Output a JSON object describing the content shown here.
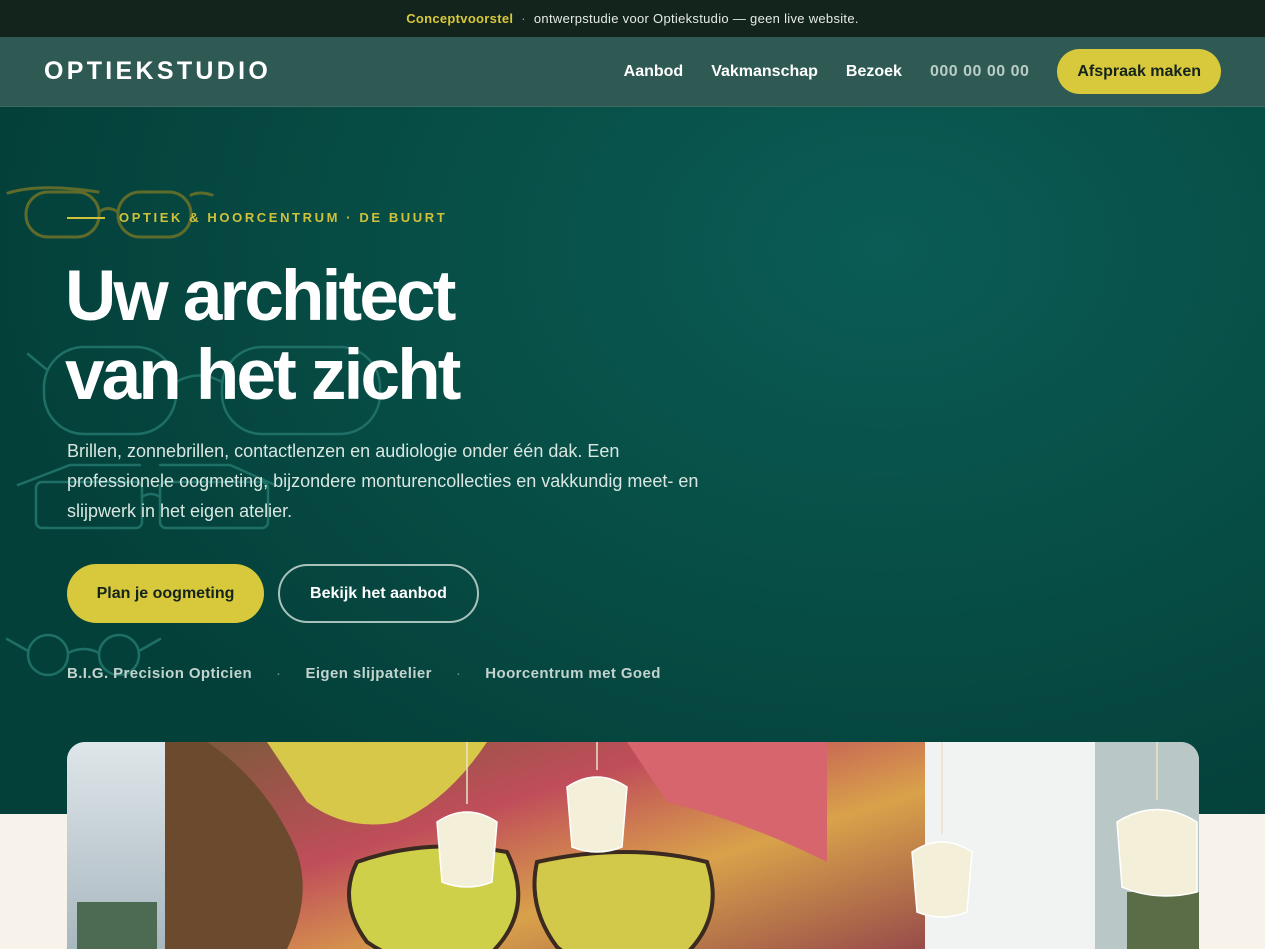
{
  "notice": {
    "tag": "Conceptvoorstel",
    "separator": "·",
    "text": "ontwerpstudie voor Optiekstudio — geen live website."
  },
  "nav": {
    "logo": "OPTIEKSTUDIO",
    "links": [
      "Aanbod",
      "Vakmanschap",
      "Bezoek"
    ],
    "phone": "000 00 00 00",
    "cta": "Afspraak maken"
  },
  "hero": {
    "eyebrow": "OPTIEK & HOORCENTRUM · DE BUURT",
    "headline_line1": "Uw architect",
    "headline_line2": "van het zicht",
    "lead": "Brillen, zonnebrillen, contactlenzen en audiologie onder één dak. Een professionele oogmeting, bijzondere monturencollecties en vakkundig meet- en slijpwerk in het eigen atelier.",
    "primary_cta": "Plan je oogmeting",
    "secondary_cta": "Bekijk het aanbod",
    "trust": [
      "B.I.G. Precision Opticien",
      "Eigen slijpatelier",
      "Hoorcentrum met Goed"
    ],
    "trust_separator": "·"
  },
  "colors": {
    "accent": "#d8c93c",
    "hero_bg": "#07504a",
    "nav_bg": "#2f5a53",
    "notice_bg": "#13241c",
    "page_bg": "#f7f3ea"
  },
  "icons": [
    "glasses-outline-icon"
  ],
  "image": "shop-interior-photo"
}
